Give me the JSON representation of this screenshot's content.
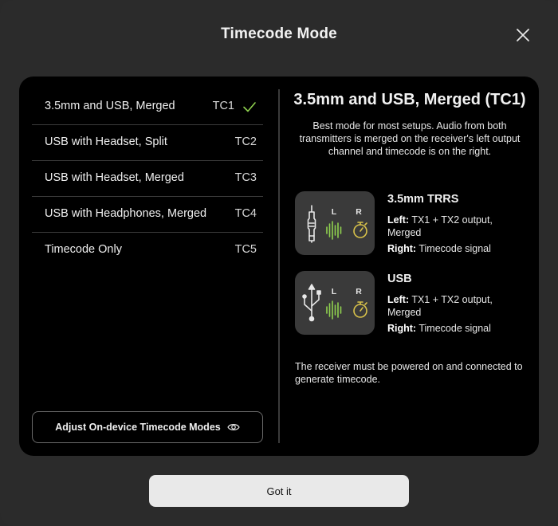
{
  "dialog": {
    "title": "Timecode Mode",
    "close_icon": "close-icon"
  },
  "modes": [
    {
      "label": "3.5mm and USB, Merged",
      "code": "TC1",
      "selected": true
    },
    {
      "label": "USB with Headset, Split",
      "code": "TC2",
      "selected": false
    },
    {
      "label": "USB with Headset, Merged",
      "code": "TC3",
      "selected": false
    },
    {
      "label": "USB with Headphones, Merged",
      "code": "TC4",
      "selected": false
    },
    {
      "label": "Timecode Only",
      "code": "TC5",
      "selected": false
    }
  ],
  "adjust_button": {
    "label": "Adjust On-device Timecode Modes",
    "icon": "eye-icon"
  },
  "detail": {
    "title": "3.5mm and USB, Merged (TC1)",
    "description": "Best mode for most setups. Audio from both transmitters is merged on the receiver's left output channel and timecode is on the right.",
    "connections": [
      {
        "name": "3.5mm TRRS",
        "icon": "audio-jack-icon",
        "left_label": "Left:",
        "left_value": "TX1 + TX2 output, Merged",
        "right_label": "Right:",
        "right_value": "Timecode signal",
        "channel_l": "L",
        "channel_r": "R"
      },
      {
        "name": "USB",
        "icon": "usb-icon",
        "left_label": "Left:",
        "left_value": "TX1 + TX2 output, Merged",
        "right_label": "Right:",
        "right_value": "Timecode signal",
        "channel_l": "L",
        "channel_r": "R"
      }
    ],
    "note": "The receiver must be powered on and connected to generate timecode."
  },
  "footer": {
    "got_it_label": "Got it"
  },
  "colors": {
    "accent_green": "#8fd14f",
    "accent_yellow": "#d8c24a",
    "panel": "#000000",
    "dialog": "#2b2b2b"
  }
}
